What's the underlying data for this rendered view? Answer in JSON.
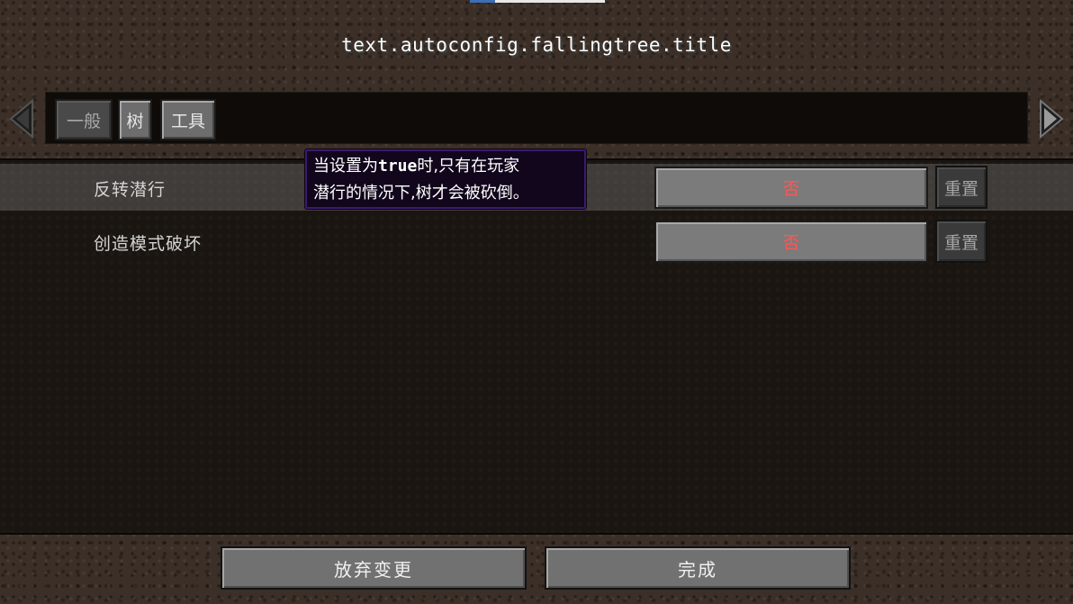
{
  "screen": {
    "title": "text.autoconfig.fallingtree.title"
  },
  "tabs": [
    {
      "label": "一般",
      "active": false
    },
    {
      "label": "树",
      "active": true
    },
    {
      "label": "工具",
      "active": false
    }
  ],
  "options": [
    {
      "label": "反转潜行",
      "value": "否",
      "reset_label": "重置",
      "highlighted": true
    },
    {
      "label": "创造模式破坏",
      "value": "否",
      "reset_label": "重置",
      "highlighted": false
    }
  ],
  "tooltip": {
    "line1_prefix": "当设置为",
    "line1_code": "true",
    "line1_suffix": "时,只有在玩家",
    "line2": "潜行的情况下,树才会被砍倒。"
  },
  "footer": {
    "discard_label": "放弃变更",
    "done_label": "完成"
  },
  "colors": {
    "value_false": "#ff5555",
    "tooltip_border": "#3a1a6e"
  },
  "icons": {
    "prev": "triangle-left",
    "next": "triangle-right"
  }
}
